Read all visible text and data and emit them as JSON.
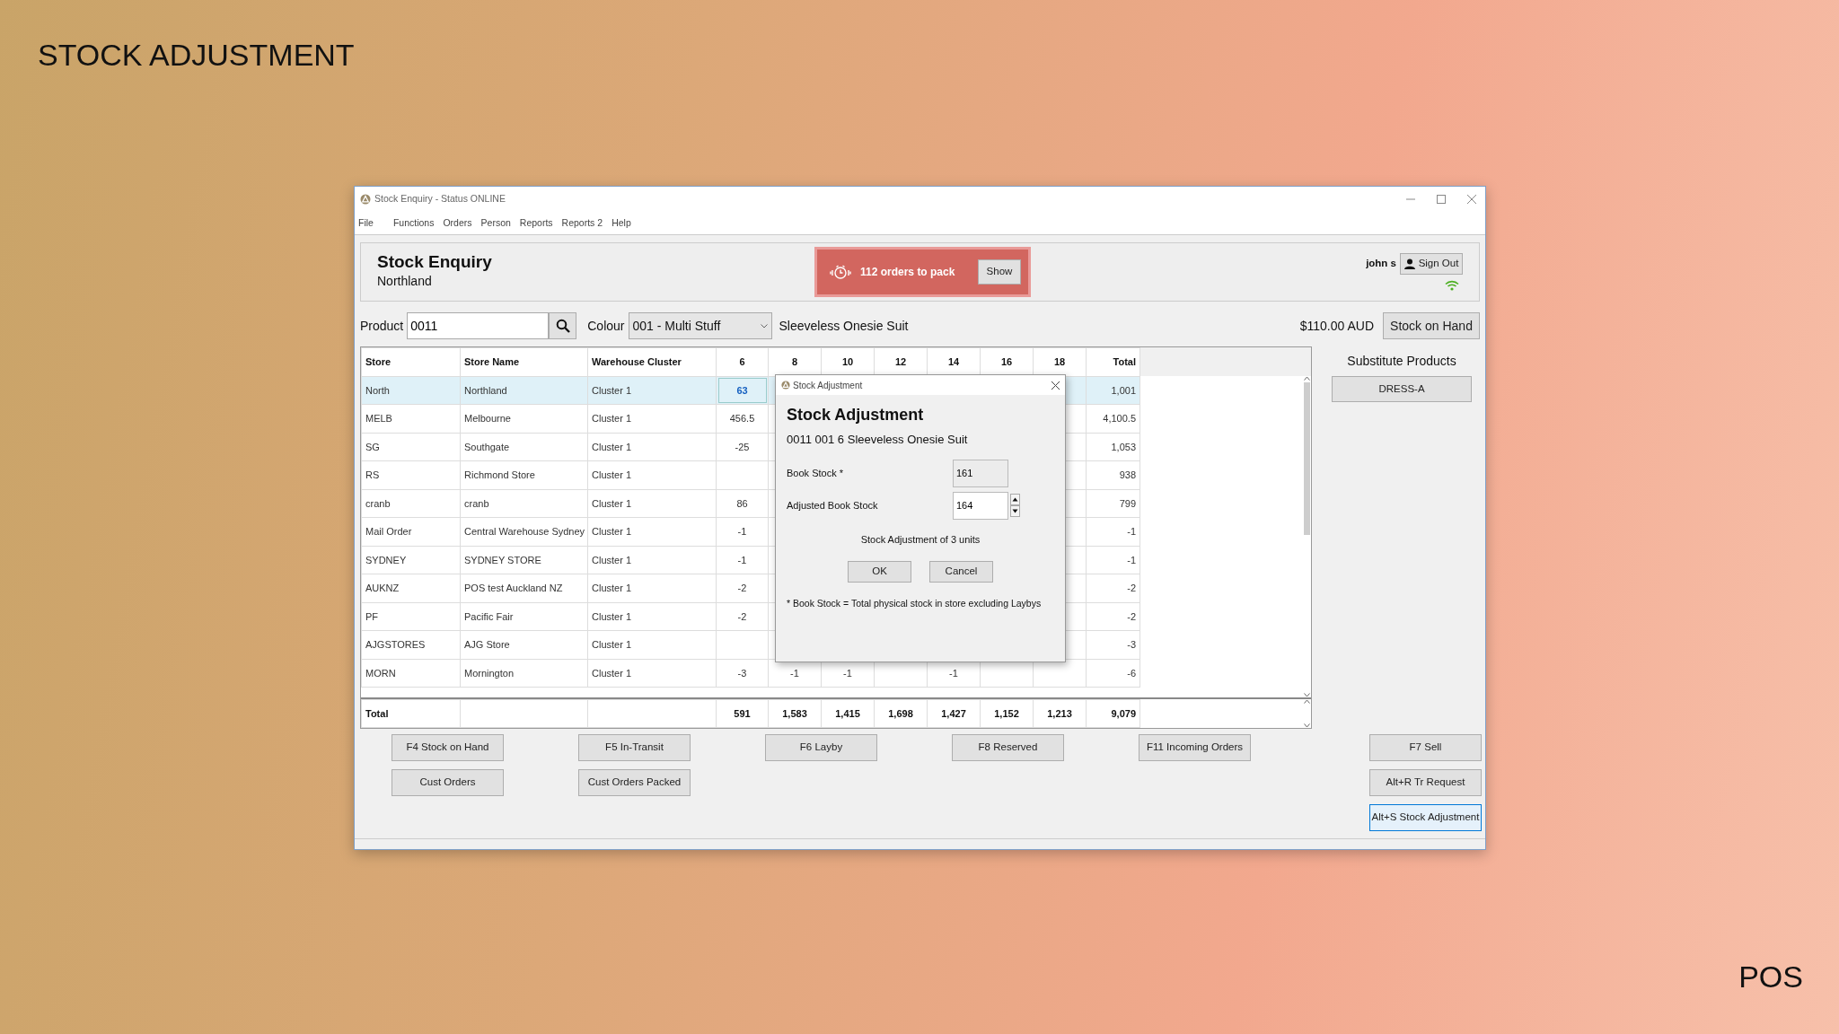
{
  "slide": {
    "title": "STOCK ADJUSTMENT",
    "footer": "POS"
  },
  "window": {
    "title": "Stock Enquiry - Status ONLINE",
    "menu": [
      "File",
      "Functions",
      "Orders",
      "Person",
      "Reports",
      "Reports 2",
      "Help"
    ]
  },
  "header": {
    "title": "Stock Enquiry",
    "subtitle": "Northland",
    "alert": {
      "text": "112 orders to pack",
      "button": "Show"
    },
    "user": "john s",
    "sign_out": "Sign Out",
    "online": true
  },
  "product": {
    "label": "Product",
    "value": "0011",
    "colour_label": "Colour",
    "colour_value": "001 - Multi Stuff",
    "description": "Sleeveless Onesie Suit",
    "price": "$110.00 AUD",
    "view_button": "Stock on Hand"
  },
  "table": {
    "columns": [
      "Store",
      "Store Name",
      "Warehouse Cluster",
      "6",
      "8",
      "10",
      "12",
      "14",
      "16",
      "18",
      "Total"
    ],
    "rows": [
      {
        "selected": true,
        "cells": [
          "North",
          "Northland",
          "Cluster 1",
          {
            "text": "63",
            "focused": true
          },
          null,
          null,
          null,
          null,
          null,
          null,
          "1,001"
        ]
      },
      {
        "selected": false,
        "cells": [
          "MELB",
          "Melbourne",
          "Cluster 1",
          "456.5",
          null,
          null,
          null,
          null,
          null,
          null,
          "4,100.5"
        ]
      },
      {
        "selected": false,
        "cells": [
          "SG",
          "Southgate",
          "Cluster 1",
          "-25",
          null,
          null,
          null,
          null,
          null,
          null,
          "1,053"
        ]
      },
      {
        "selected": false,
        "cells": [
          "RS",
          "Richmond Store",
          "Cluster 1",
          null,
          null,
          null,
          null,
          null,
          null,
          null,
          "938"
        ]
      },
      {
        "selected": false,
        "cells": [
          "cranb",
          "cranb",
          "Cluster 1",
          "86",
          null,
          null,
          null,
          null,
          null,
          null,
          "799"
        ]
      },
      {
        "selected": false,
        "cells": [
          "Mail Order",
          "Central Warehouse Sydney",
          "Cluster 1",
          "-1",
          null,
          null,
          null,
          null,
          null,
          null,
          "-1"
        ]
      },
      {
        "selected": false,
        "cells": [
          "SYDNEY",
          "SYDNEY STORE",
          "Cluster 1",
          "-1",
          null,
          null,
          null,
          null,
          null,
          null,
          "-1"
        ]
      },
      {
        "selected": false,
        "cells": [
          "AUKNZ",
          "POS test Auckland NZ",
          "Cluster 1",
          "-2",
          null,
          null,
          null,
          null,
          null,
          null,
          "-2"
        ]
      },
      {
        "selected": false,
        "cells": [
          "PF",
          "Pacific Fair",
          "Cluster 1",
          "-2",
          null,
          null,
          null,
          null,
          null,
          null,
          "-2"
        ]
      },
      {
        "selected": false,
        "cells": [
          "AJGSTORES",
          "AJG Store",
          "Cluster 1",
          null,
          null,
          null,
          null,
          null,
          null,
          null,
          "-3"
        ]
      },
      {
        "selected": false,
        "cells": [
          "MORN",
          "Mornington",
          "Cluster 1",
          "-3",
          "-1",
          "-1",
          null,
          "-1",
          null,
          null,
          "-6"
        ]
      }
    ],
    "total": {
      "label": "Total",
      "values": [
        "591",
        "1,583",
        "1,415",
        "1,698",
        "1,427",
        "1,152",
        "1,213",
        "9,079"
      ]
    }
  },
  "substitutes": {
    "title": "Substitute Products",
    "items": [
      "DRESS-A"
    ]
  },
  "button_rows": [
    [
      {
        "label": "F4 Stock on Hand"
      },
      {
        "label": "F5 In-Transit"
      },
      {
        "label": "F6 Layby"
      },
      {
        "label": "F8 Reserved"
      },
      {
        "label": "F11 Incoming Orders"
      }
    ],
    [
      {
        "label": "Cust Orders"
      },
      {
        "label": "Cust Orders Packed"
      }
    ]
  ],
  "side_buttons": [
    {
      "label": "F7 Sell",
      "focused": false
    },
    {
      "label": "Alt+R Tr Request",
      "focused": false
    },
    {
      "label": "Alt+S Stock Adjustment",
      "focused": true
    }
  ],
  "dialog": {
    "window_title": "Stock Adjustment",
    "title": "Stock Adjustment",
    "subtitle": "0011 001 6 Sleeveless Onesie Suit",
    "fields": [
      {
        "label": "Book Stock *",
        "value": "161",
        "readonly": true,
        "spinner": false
      },
      {
        "label": "Adjusted Book Stock",
        "value": "164",
        "readonly": false,
        "spinner": true
      }
    ],
    "message": "Stock Adjustment of 3 units",
    "buttons": [
      "OK",
      "Cancel"
    ],
    "note": "* Book Stock = Total physical stock in store excluding Laybys"
  }
}
